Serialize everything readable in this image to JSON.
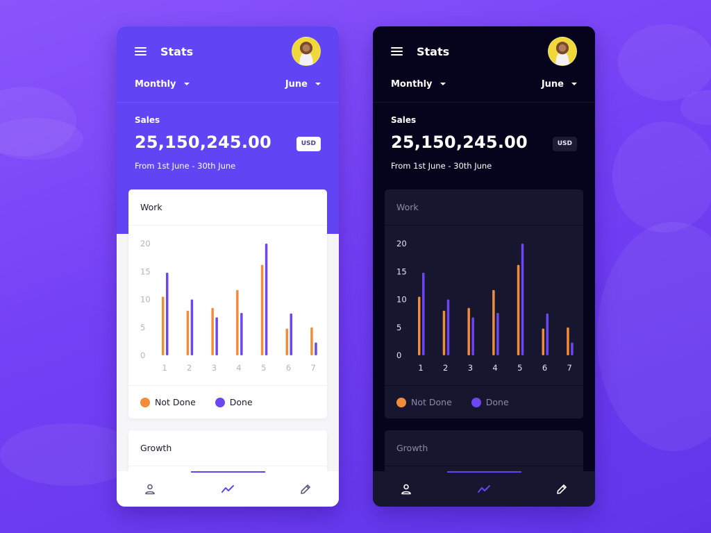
{
  "colors": {
    "accent": "#6145f5",
    "not_done": "#f28c38",
    "done": "#6c47f0",
    "light_axis": "#b3b3c3",
    "dark_axis": "#8c8aa8"
  },
  "screens": [
    {
      "theme": "light",
      "header": {
        "title": "Stats",
        "menu_icon": "hamburger-menu-icon",
        "avatar": "user-avatar"
      },
      "filters": {
        "period": "Monthly",
        "month": "June"
      },
      "sales": {
        "label": "Sales",
        "value": "25,150,245.00",
        "currency": "USD",
        "range": "From 1st June - 30th June"
      },
      "work_card": {
        "title": "Work",
        "legend": [
          "Not Done",
          "Done"
        ]
      },
      "growth_card": {
        "title": "Growth"
      },
      "bottom_nav": [
        {
          "icon": "profile-icon",
          "active": false
        },
        {
          "icon": "trending-chart-icon",
          "active": true
        },
        {
          "icon": "pencil-edit-icon",
          "active": false
        }
      ]
    },
    {
      "theme": "dark",
      "header": {
        "title": "Stats",
        "menu_icon": "hamburger-menu-icon",
        "avatar": "user-avatar"
      },
      "filters": {
        "period": "Monthly",
        "month": "June"
      },
      "sales": {
        "label": "Sales",
        "value": "25,150,245.00",
        "currency": "USD",
        "range": "From 1st June - 30th June"
      },
      "work_card": {
        "title": "Work",
        "legend": [
          "Not Done",
          "Done"
        ]
      },
      "growth_card": {
        "title": "Growth"
      },
      "bottom_nav": [
        {
          "icon": "profile-icon",
          "active": false
        },
        {
          "icon": "trending-chart-icon",
          "active": true
        },
        {
          "icon": "pencil-edit-icon",
          "active": false
        }
      ]
    }
  ],
  "chart_data": {
    "type": "bar",
    "title": "Work",
    "categories": [
      "1",
      "2",
      "3",
      "4",
      "5",
      "6",
      "7"
    ],
    "series": [
      {
        "name": "Not Done",
        "values": [
          10.5,
          8,
          8.5,
          11.7,
          16.2,
          4.8,
          5
        ]
      },
      {
        "name": "Done",
        "values": [
          14.8,
          10,
          6.8,
          7.6,
          20,
          7.5,
          2.3
        ]
      }
    ],
    "ylim": [
      0,
      20
    ],
    "yticks": [
      0,
      5,
      10,
      15,
      20
    ],
    "xlabel": "",
    "ylabel": "",
    "grid": false,
    "legend": "bottom-left"
  }
}
